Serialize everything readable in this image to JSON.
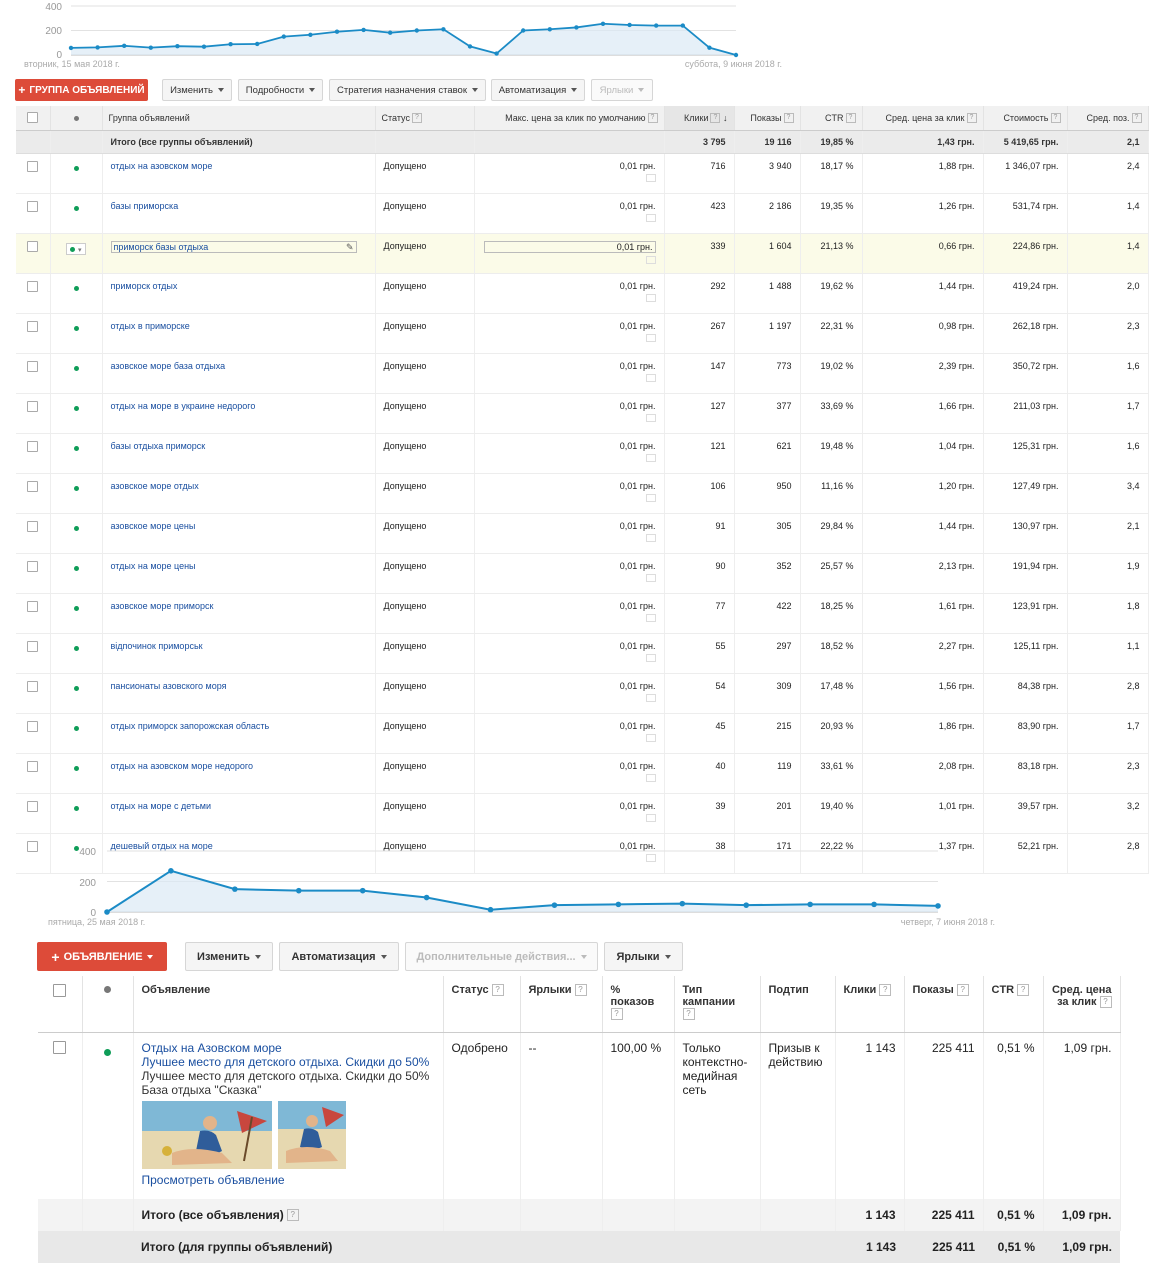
{
  "chart1": {
    "y_ticks": [
      "400",
      "200",
      "0"
    ],
    "start_date": "вторник, 15 мая 2018 г.",
    "end_date": "суббота, 9 июня 2018 г."
  },
  "chart2": {
    "y_ticks": [
      "400",
      "200",
      "0"
    ],
    "start_date": "пятница, 25 мая 2018 г.",
    "end_date": "четверг, 7 июня 2018 г."
  },
  "chart_data": [
    {
      "type": "area",
      "x": [
        "2018-05-15",
        "2018-05-16",
        "2018-05-17",
        "2018-05-18",
        "2018-05-19",
        "2018-05-20",
        "2018-05-21",
        "2018-05-22",
        "2018-05-23",
        "2018-05-24",
        "2018-05-25",
        "2018-05-26",
        "2018-05-27",
        "2018-05-28",
        "2018-05-29",
        "2018-05-30",
        "2018-05-31",
        "2018-06-01",
        "2018-06-02",
        "2018-06-03",
        "2018-06-04",
        "2018-06-05",
        "2018-06-06",
        "2018-06-07",
        "2018-06-08",
        "2018-06-09"
      ],
      "values": [
        58,
        62,
        75,
        60,
        72,
        68,
        88,
        90,
        150,
        165,
        190,
        205,
        182,
        200,
        210,
        70,
        12,
        200,
        210,
        225,
        255,
        245,
        240,
        240,
        60,
        0
      ],
      "ylim": [
        0,
        400
      ],
      "grid": true,
      "title": "",
      "xlabel": "",
      "ylabel": ""
    },
    {
      "type": "area",
      "x": [
        "2018-05-25",
        "2018-05-26",
        "2018-05-27",
        "2018-05-28",
        "2018-05-29",
        "2018-05-30",
        "2018-05-31",
        "2018-06-01",
        "2018-06-02",
        "2018-06-03",
        "2018-06-04",
        "2018-06-05",
        "2018-06-06",
        "2018-06-07"
      ],
      "values": [
        0,
        270,
        150,
        140,
        140,
        95,
        15,
        45,
        50,
        55,
        45,
        50,
        50,
        40
      ],
      "ylim": [
        0,
        400
      ],
      "grid": true,
      "title": "",
      "xlabel": "",
      "ylabel": ""
    }
  ],
  "toolbar1": {
    "add_label": "ГРУППА ОБЪЯВЛЕНИЙ",
    "edit_label": "Изменить",
    "details_label": "Подробности",
    "bid_strategy_label": "Стратегия назначения ставок",
    "automation_label": "Автоматизация",
    "labels_label": "Ярлыки"
  },
  "adgroups": {
    "headers": {
      "name": "Группа объявлений",
      "status": "Статус",
      "max_cpc": "Макс. цена за клик по умолчанию",
      "clicks": "Клики",
      "impressions": "Показы",
      "ctr": "CTR",
      "avg_cpc": "Сред. цена за клик",
      "cost": "Стоимость",
      "avg_pos": "Сред. поз."
    },
    "total": {
      "label": "Итого (все группы объявлений)",
      "clicks": "3 795",
      "impressions": "19 116",
      "ctr": "19,85 %",
      "avg_cpc": "1,43 грн.",
      "cost": "5 419,65 грн.",
      "avg_pos": "2,1"
    },
    "rows": [
      {
        "name": "отдых на азовском море",
        "status": "Допущено",
        "bid": "0,01 грн.",
        "clicks": "716",
        "impressions": "3 940",
        "ctr": "18,17 %",
        "avg_cpc": "1,88 грн.",
        "cost": "1 346,07 грн.",
        "pos": "2,4"
      },
      {
        "name": "базы приморска",
        "status": "Допущено",
        "bid": "0,01 грн.",
        "clicks": "423",
        "impressions": "2 186",
        "ctr": "19,35 %",
        "avg_cpc": "1,26 грн.",
        "cost": "531,74 грн.",
        "pos": "1,4"
      },
      {
        "name": "приморск базы отдыха",
        "status": "Допущено",
        "bid": "0,01 грн.",
        "clicks": "339",
        "impressions": "1 604",
        "ctr": "21,13 %",
        "avg_cpc": "0,66 грн.",
        "cost": "224,86 грн.",
        "pos": "1,4"
      },
      {
        "name": "приморск отдых",
        "status": "Допущено",
        "bid": "0,01 грн.",
        "clicks": "292",
        "impressions": "1 488",
        "ctr": "19,62 %",
        "avg_cpc": "1,44 грн.",
        "cost": "419,24 грн.",
        "pos": "2,0"
      },
      {
        "name": "отдых в приморске",
        "status": "Допущено",
        "bid": "0,01 грн.",
        "clicks": "267",
        "impressions": "1 197",
        "ctr": "22,31 %",
        "avg_cpc": "0,98 грн.",
        "cost": "262,18 грн.",
        "pos": "2,3"
      },
      {
        "name": "азовское море база отдыха",
        "status": "Допущено",
        "bid": "0,01 грн.",
        "clicks": "147",
        "impressions": "773",
        "ctr": "19,02 %",
        "avg_cpc": "2,39 грн.",
        "cost": "350,72 грн.",
        "pos": "1,6"
      },
      {
        "name": "отдых на море в украине недорого",
        "status": "Допущено",
        "bid": "0,01 грн.",
        "clicks": "127",
        "impressions": "377",
        "ctr": "33,69 %",
        "avg_cpc": "1,66 грн.",
        "cost": "211,03 грн.",
        "pos": "1,7"
      },
      {
        "name": "базы отдыха приморск",
        "status": "Допущено",
        "bid": "0,01 грн.",
        "clicks": "121",
        "impressions": "621",
        "ctr": "19,48 %",
        "avg_cpc": "1,04 грн.",
        "cost": "125,31 грн.",
        "pos": "1,6"
      },
      {
        "name": "азовское море отдых",
        "status": "Допущено",
        "bid": "0,01 грн.",
        "clicks": "106",
        "impressions": "950",
        "ctr": "11,16 %",
        "avg_cpc": "1,20 грн.",
        "cost": "127,49 грн.",
        "pos": "3,4"
      },
      {
        "name": "азовское море цены",
        "status": "Допущено",
        "bid": "0,01 грн.",
        "clicks": "91",
        "impressions": "305",
        "ctr": "29,84 %",
        "avg_cpc": "1,44 грн.",
        "cost": "130,97 грн.",
        "pos": "2,1"
      },
      {
        "name": "отдых на море цены",
        "status": "Допущено",
        "bid": "0,01 грн.",
        "clicks": "90",
        "impressions": "352",
        "ctr": "25,57 %",
        "avg_cpc": "2,13 грн.",
        "cost": "191,94 грн.",
        "pos": "1,9"
      },
      {
        "name": "азовское море приморск",
        "status": "Допущено",
        "bid": "0,01 грн.",
        "clicks": "77",
        "impressions": "422",
        "ctr": "18,25 %",
        "avg_cpc": "1,61 грн.",
        "cost": "123,91 грн.",
        "pos": "1,8"
      },
      {
        "name": "відпочинок приморськ",
        "status": "Допущено",
        "bid": "0,01 грн.",
        "clicks": "55",
        "impressions": "297",
        "ctr": "18,52 %",
        "avg_cpc": "2,27 грн.",
        "cost": "125,11 грн.",
        "pos": "1,1"
      },
      {
        "name": "пансионаты азовского моря",
        "status": "Допущено",
        "bid": "0,01 грн.",
        "clicks": "54",
        "impressions": "309",
        "ctr": "17,48 %",
        "avg_cpc": "1,56 грн.",
        "cost": "84,38 грн.",
        "pos": "2,8"
      },
      {
        "name": "отдых приморск запорожская область",
        "status": "Допущено",
        "bid": "0,01 грн.",
        "clicks": "45",
        "impressions": "215",
        "ctr": "20,93 %",
        "avg_cpc": "1,86 грн.",
        "cost": "83,90 грн.",
        "pos": "1,7"
      },
      {
        "name": "отдых на азовском море недорого",
        "status": "Допущено",
        "bid": "0,01 грн.",
        "clicks": "40",
        "impressions": "119",
        "ctr": "33,61 %",
        "avg_cpc": "2,08 грн.",
        "cost": "83,18 грн.",
        "pos": "2,3"
      },
      {
        "name": "отдых на море с детьми",
        "status": "Допущено",
        "bid": "0,01 грн.",
        "clicks": "39",
        "impressions": "201",
        "ctr": "19,40 %",
        "avg_cpc": "1,01 грн.",
        "cost": "39,57 грн.",
        "pos": "3,2"
      },
      {
        "name": "дешевый отдых на море",
        "status": "Допущено",
        "bid": "0,01 грн.",
        "clicks": "38",
        "impressions": "171",
        "ctr": "22,22 %",
        "avg_cpc": "1,37 грн.",
        "cost": "52,21 грн.",
        "pos": "2,8"
      }
    ]
  },
  "toolbar2": {
    "add_label": "ОБЪЯВЛЕНИЕ",
    "edit_label": "Изменить",
    "automation_label": "Автоматизация",
    "more_label": "Дополнительные действия...",
    "labels_label": "Ярлыки"
  },
  "ads": {
    "headers": {
      "ad": "Объявление",
      "status": "Статус",
      "labels": "Ярлыки",
      "pct_served": "% показов",
      "campaign_type": "Тип кампании",
      "subtype": "Подтип",
      "clicks": "Клики",
      "impressions": "Показы",
      "ctr": "CTR",
      "avg_cpc": "Сред. цена за клик"
    },
    "row": {
      "headline": "Отдых на Азовском море",
      "line2": "Лучшее место для детского отдыха. Скидки до 50%",
      "line3": "Лучшее место для детского отдыха. Скидки до 50%",
      "line4": "База отдыха \"Сказка\"",
      "view_link": "Просмотреть объявление",
      "status": "Одобрено",
      "labels": "--",
      "pct_served": "100,00 %",
      "campaign_type": "Только контекстно-медийная сеть",
      "subtype": "Призыв к действию",
      "clicks": "1 143",
      "impressions": "225 411",
      "ctr": "0,51 %",
      "avg_cpc": "1,09 грн."
    },
    "total_all": {
      "label": "Итого (все объявления)",
      "clicks": "1 143",
      "impressions": "225 411",
      "ctr": "0,51 %",
      "avg_cpc": "1,09 грн."
    },
    "total_group": {
      "label": "Итого (для группы объявлений)",
      "clicks": "1 143",
      "impressions": "225 411",
      "ctr": "0,51 %",
      "avg_cpc": "1,09 грн."
    }
  }
}
